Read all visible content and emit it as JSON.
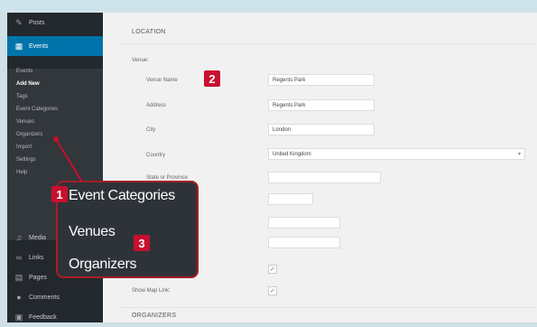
{
  "sidebar": {
    "items_top": [
      {
        "label": "Posts",
        "icon": "pushpin-icon"
      },
      {
        "label": "Events",
        "icon": "calendar-icon"
      }
    ],
    "submenu": [
      "Events",
      "Add New",
      "Tags",
      "Event Categories",
      "Venues",
      "Organizers",
      "Import",
      "Settings",
      "Help",
      ""
    ],
    "items_bottom": [
      {
        "label": "Media",
        "icon": "media-icon"
      },
      {
        "label": "Links",
        "icon": "links-icon"
      },
      {
        "label": "Pages",
        "icon": "pages-icon"
      },
      {
        "label": "Comments",
        "icon": "comments-icon"
      },
      {
        "label": "Feedback",
        "icon": "feedback-icon"
      }
    ]
  },
  "main": {
    "location_title": "LOCATION",
    "venue_label": "Venue:",
    "fields": [
      {
        "label": "Venue Name",
        "value": "Regents Park"
      },
      {
        "label": "Address",
        "value": "Regents Park"
      },
      {
        "label": "City",
        "value": "London"
      },
      {
        "label": "Country",
        "value": "United Kingdom"
      },
      {
        "label": "State or Province",
        "value": ""
      }
    ],
    "show_map_link_label": "Show Map Link:",
    "organizers_title": "ORGANIZERS"
  },
  "callout": {
    "items": [
      "Event Categories",
      "Venues",
      "Organizers"
    ]
  },
  "badges": [
    "1",
    "2",
    "3"
  ],
  "colors": {
    "accent": "#0073aa",
    "badge": "#c8102e",
    "sidebar": "#23282d"
  }
}
